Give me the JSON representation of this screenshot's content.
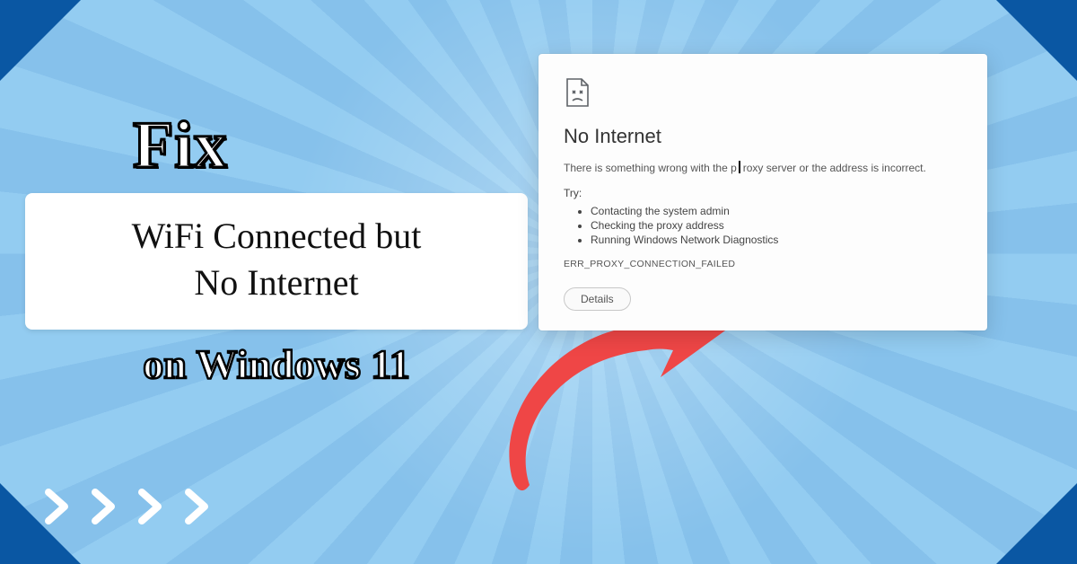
{
  "headline": {
    "fix": "Fix",
    "line1": "WiFi Connected but",
    "line2": "No Internet",
    "on_windows": "on Windows 11"
  },
  "error_window": {
    "title": "No Internet",
    "description_part1": "There is something wrong with the p",
    "description_part2": "roxy server or the address is incorrect.",
    "try_label": "Try:",
    "suggestions": {
      "item1": "Contacting the system admin",
      "item2": "Checking the proxy address",
      "item3": "Running Windows Network Diagnostics"
    },
    "error_code": "ERR_PROXY_CONNECTION_FAILED",
    "details_button": "Details"
  },
  "colors": {
    "bg_blue": "#8cc5ed",
    "corner_blue": "#0a57a3",
    "arrow_red": "#ef4646",
    "link_blue": "#1a6fd1"
  }
}
